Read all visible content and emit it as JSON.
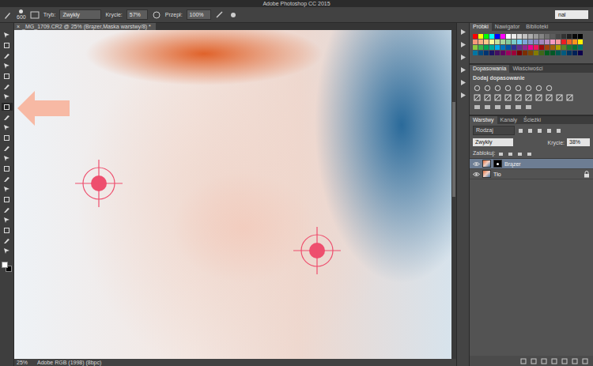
{
  "window": {
    "title": "Adobe Photoshop CC 2015"
  },
  "options_bar": {
    "brush_size": "600",
    "mode_label": "Tryb:",
    "mode_value": "Zwykły",
    "opacity_label": "Krycie:",
    "opacity_value": "57%",
    "flow_label": "Przepł:",
    "flow_value": "100%",
    "search_value": "nal"
  },
  "document": {
    "tab_title": "_MG_1709.CR2 @ 25% (Brązer,Maska warstwy/8) *",
    "close_glyph": "×"
  },
  "tools": [
    {
      "selected": false
    },
    {
      "selected": false
    },
    {
      "selected": false
    },
    {
      "selected": false
    },
    {
      "selected": false
    },
    {
      "selected": false
    },
    {
      "selected": false
    },
    {
      "selected": true
    },
    {
      "selected": false
    },
    {
      "selected": false
    },
    {
      "selected": false
    },
    {
      "selected": false
    },
    {
      "selected": false
    },
    {
      "selected": false
    },
    {
      "selected": false
    },
    {
      "selected": false
    },
    {
      "selected": false
    },
    {
      "selected": false
    },
    {
      "selected": false
    },
    {
      "selected": false
    },
    {
      "selected": false
    },
    {
      "selected": false
    }
  ],
  "tool_colors": [
    {
      "color": "#ffffff"
    },
    {
      "color": "#000000"
    }
  ],
  "status_bar": {
    "zoom": "25%",
    "profile": "Adobe RGB (1998) (8bpc)"
  },
  "swatches_panel": {
    "tabs": [
      {
        "label": "Próbki",
        "selected": true
      },
      {
        "label": "Nawigator",
        "selected": false
      },
      {
        "label": "Biblioteki",
        "selected": false
      }
    ],
    "swatches": [
      {
        "color": "#ff0000"
      },
      {
        "color": "#ffff00"
      },
      {
        "color": "#00ff00"
      },
      {
        "color": "#00ffff"
      },
      {
        "color": "#0000ff"
      },
      {
        "color": "#ff00ff"
      },
      {
        "color": "#ffffff"
      },
      {
        "color": "#ebebeb"
      },
      {
        "color": "#d6d6d6"
      },
      {
        "color": "#c2c2c2"
      },
      {
        "color": "#adadad"
      },
      {
        "color": "#999999"
      },
      {
        "color": "#858585"
      },
      {
        "color": "#707070"
      },
      {
        "color": "#5c5c5c"
      },
      {
        "color": "#474747"
      },
      {
        "color": "#333333"
      },
      {
        "color": "#1f1f1f"
      },
      {
        "color": "#0a0a0a"
      },
      {
        "color": "#000000"
      },
      {
        "color": "#f7977a"
      },
      {
        "color": "#f9ad81"
      },
      {
        "color": "#fdc68a"
      },
      {
        "color": "#fff79a"
      },
      {
        "color": "#c4df9b"
      },
      {
        "color": "#a2d39c"
      },
      {
        "color": "#82ca9d"
      },
      {
        "color": "#7bcdc8"
      },
      {
        "color": "#6ecff6"
      },
      {
        "color": "#7ea7d8"
      },
      {
        "color": "#8493ca"
      },
      {
        "color": "#8882be"
      },
      {
        "color": "#a187be"
      },
      {
        "color": "#bc8dbf"
      },
      {
        "color": "#f49ac2"
      },
      {
        "color": "#f6989d"
      },
      {
        "color": "#ed1c24"
      },
      {
        "color": "#f26522"
      },
      {
        "color": "#f7941d"
      },
      {
        "color": "#fff200"
      },
      {
        "color": "#8dc73f"
      },
      {
        "color": "#39b54a"
      },
      {
        "color": "#00a651"
      },
      {
        "color": "#00a99d"
      },
      {
        "color": "#00aeef"
      },
      {
        "color": "#0072bc"
      },
      {
        "color": "#0054a6"
      },
      {
        "color": "#2e3192"
      },
      {
        "color": "#662d91"
      },
      {
        "color": "#92278f"
      },
      {
        "color": "#ec008c"
      },
      {
        "color": "#ed145b"
      },
      {
        "color": "#9e0b0f"
      },
      {
        "color": "#a0410d"
      },
      {
        "color": "#a36209"
      },
      {
        "color": "#aba000"
      },
      {
        "color": "#598527"
      },
      {
        "color": "#1a7b30"
      },
      {
        "color": "#007236"
      },
      {
        "color": "#00746b"
      },
      {
        "color": "#0076a3"
      },
      {
        "color": "#004b80"
      },
      {
        "color": "#003471"
      },
      {
        "color": "#1b1464"
      },
      {
        "color": "#440e62"
      },
      {
        "color": "#630460"
      },
      {
        "color": "#9e005d"
      },
      {
        "color": "#9e0039"
      },
      {
        "color": "#790000"
      },
      {
        "color": "#7b2e00"
      },
      {
        "color": "#7d4900"
      },
      {
        "color": "#827b00"
      },
      {
        "color": "#406618"
      },
      {
        "color": "#005e20"
      },
      {
        "color": "#005826"
      },
      {
        "color": "#005952"
      },
      {
        "color": "#005b7f"
      },
      {
        "color": "#003663"
      },
      {
        "color": "#002157"
      },
      {
        "color": "#0d004c"
      }
    ]
  },
  "adjustments_panel": {
    "tabs": [
      {
        "label": "Dopasowania",
        "selected": true
      },
      {
        "label": "Właściwości",
        "selected": false
      }
    ],
    "heading": "Dodaj dopasowanie"
  },
  "layers_panel": {
    "tabs": [
      {
        "label": "Warstwy",
        "selected": true
      },
      {
        "label": "Kanały",
        "selected": false
      },
      {
        "label": "Ścieżki",
        "selected": false
      }
    ],
    "filter": "Rodzaj",
    "blend_mode": "Zwykły",
    "opacity_label": "Krycie:",
    "opacity_value": "38%",
    "lock_label": "Zablokuj:",
    "layers": [
      {
        "name": "Brązer",
        "selected": true,
        "visible": true,
        "has_mask": true,
        "locked": false
      },
      {
        "name": "Tło",
        "selected": false,
        "visible": true,
        "has_mask": false,
        "locked": true
      }
    ]
  }
}
